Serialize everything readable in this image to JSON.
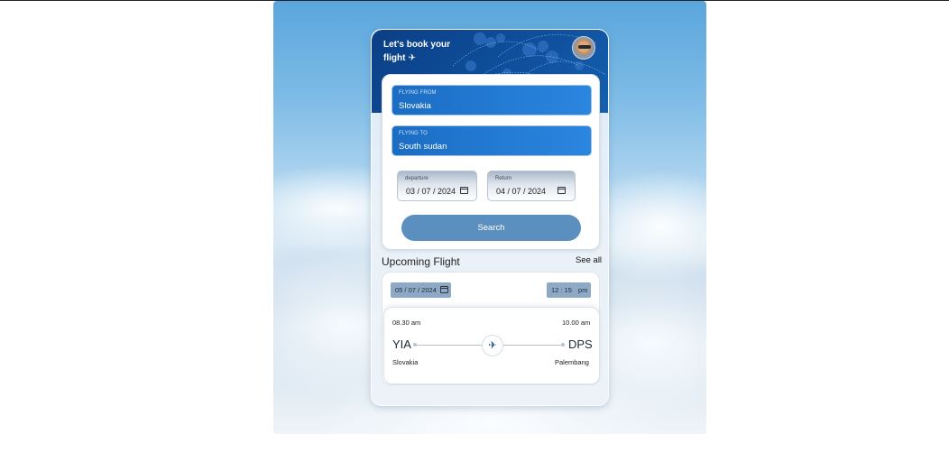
{
  "header": {
    "title_line1": "Let's book your",
    "title_line2": "flight",
    "plane_glyph": "✈"
  },
  "form": {
    "from_label": "FLYING FROM",
    "from_value": "Slovakia",
    "to_label": "FLYING TO",
    "to_value": "South sudan",
    "departure_label": "departure",
    "departure_value": "03 / 07 / 2024",
    "return_label": "Return",
    "return_value": "04 / 07 / 2024",
    "search_label": "Search"
  },
  "upcoming": {
    "heading": "Upcoming Flight",
    "see_all": "See all",
    "date": "05 / 07 / 2024",
    "time": "12 : 15",
    "time_suffix": "pm",
    "depart_time": "08.30 am",
    "arrive_time": "10.00 am",
    "origin_code": "YIA",
    "destination_code": "DPS",
    "origin_city": "Slovakia",
    "destination_city": "Palembang"
  },
  "colors": {
    "header_blue": "#0f4f9c",
    "field_blue": "#2b86df",
    "button_blue": "#5b8fbf",
    "chip_blue": "#8ea9c6"
  },
  "icons": [
    "plane-icon",
    "avatar",
    "calendar-icon",
    "airplane-icon"
  ]
}
